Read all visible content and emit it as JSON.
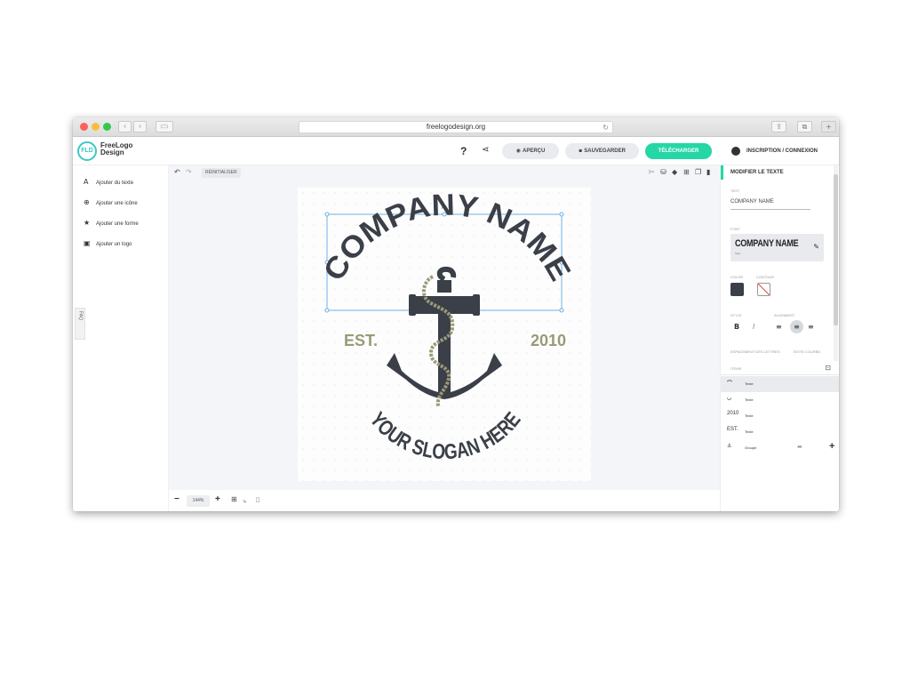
{
  "browser": {
    "url": "freelogodesign.org"
  },
  "header": {
    "logo_mark": "FLD",
    "logo_line1": "FreeLogo",
    "logo_line2": "Design",
    "help": "?",
    "preview_label": "APERÇU",
    "save_label": "SAUVEGARDER",
    "download_label": "TÉLÉCHARGER",
    "auth_label": "INSCRIPTION  /  CONNEXION",
    "accent_color": "#25d6a6"
  },
  "sidebar": {
    "items": [
      {
        "icon": "text-icon",
        "label": "Ajouter du texte"
      },
      {
        "icon": "globe-icon",
        "label": "Ajouter une icône"
      },
      {
        "icon": "star-icon",
        "label": "Ajouter une forme"
      },
      {
        "icon": "image-icon",
        "label": "Ajouter un logo"
      }
    ],
    "faq": "FAQ"
  },
  "canvas": {
    "reset_label": "RÉINITIALISER",
    "zoom": "144%",
    "logo": {
      "company": "COMPANY NAME",
      "est": "EST.",
      "year": "2010",
      "slogan": "YOUR SLOGAN HERE",
      "dark_color": "#3a3f48",
      "accent_color": "#9a9a78"
    }
  },
  "panel": {
    "title": "MODIFIER LE TEXTE",
    "text_label": "TEXT",
    "text_value": "COMPANY NAME",
    "font_label": "FONT",
    "font_name": "COMPANY NAME",
    "font_sub": "Teko",
    "color_label": "COLOR",
    "contour_label": "CONTOUR",
    "style_label": "STYLE",
    "alignment_label": "ALIGNMENT",
    "bold": "B",
    "italic": "I",
    "spacing_label": "ESPACEMENT DES LETTRES",
    "text_size_label": "TEXTE COURBE",
    "layers_label": "ITEMS",
    "layers": [
      {
        "thumb": "⌒",
        "name": "Texte"
      },
      {
        "thumb": "◡",
        "name": "Texte"
      },
      {
        "thumb": "2010",
        "name": "Texte"
      },
      {
        "thumb": "EST.",
        "name": "Texte"
      },
      {
        "thumb": "⚓",
        "name": "Groupe"
      }
    ]
  }
}
